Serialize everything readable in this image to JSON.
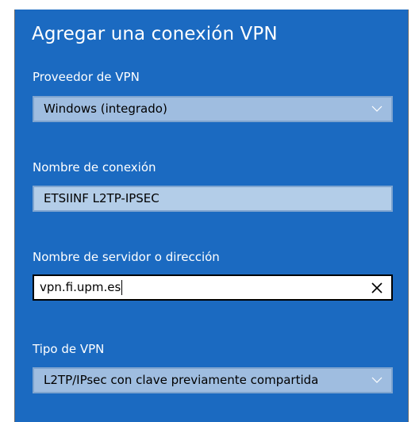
{
  "dialog": {
    "title": "Agregar una conexión VPN"
  },
  "provider": {
    "label": "Proveedor de VPN",
    "selected": "Windows (integrado)",
    "icon": "chevron-down-icon"
  },
  "connection_name": {
    "label": "Nombre de conexión",
    "value": "ETSIINF L2TP-IPSEC"
  },
  "server": {
    "label": "Nombre de servidor o dirección",
    "value": "vpn.fi.upm.es",
    "clear_icon": "close-icon"
  },
  "vpn_type": {
    "label": "Tipo de VPN",
    "selected": "L2TP/IPsec con clave previamente compartida",
    "icon": "chevron-down-icon"
  },
  "colors": {
    "accent": "#1b6ac1",
    "field_inactive": "#a7c4e5",
    "field_active": "#ffffff"
  }
}
